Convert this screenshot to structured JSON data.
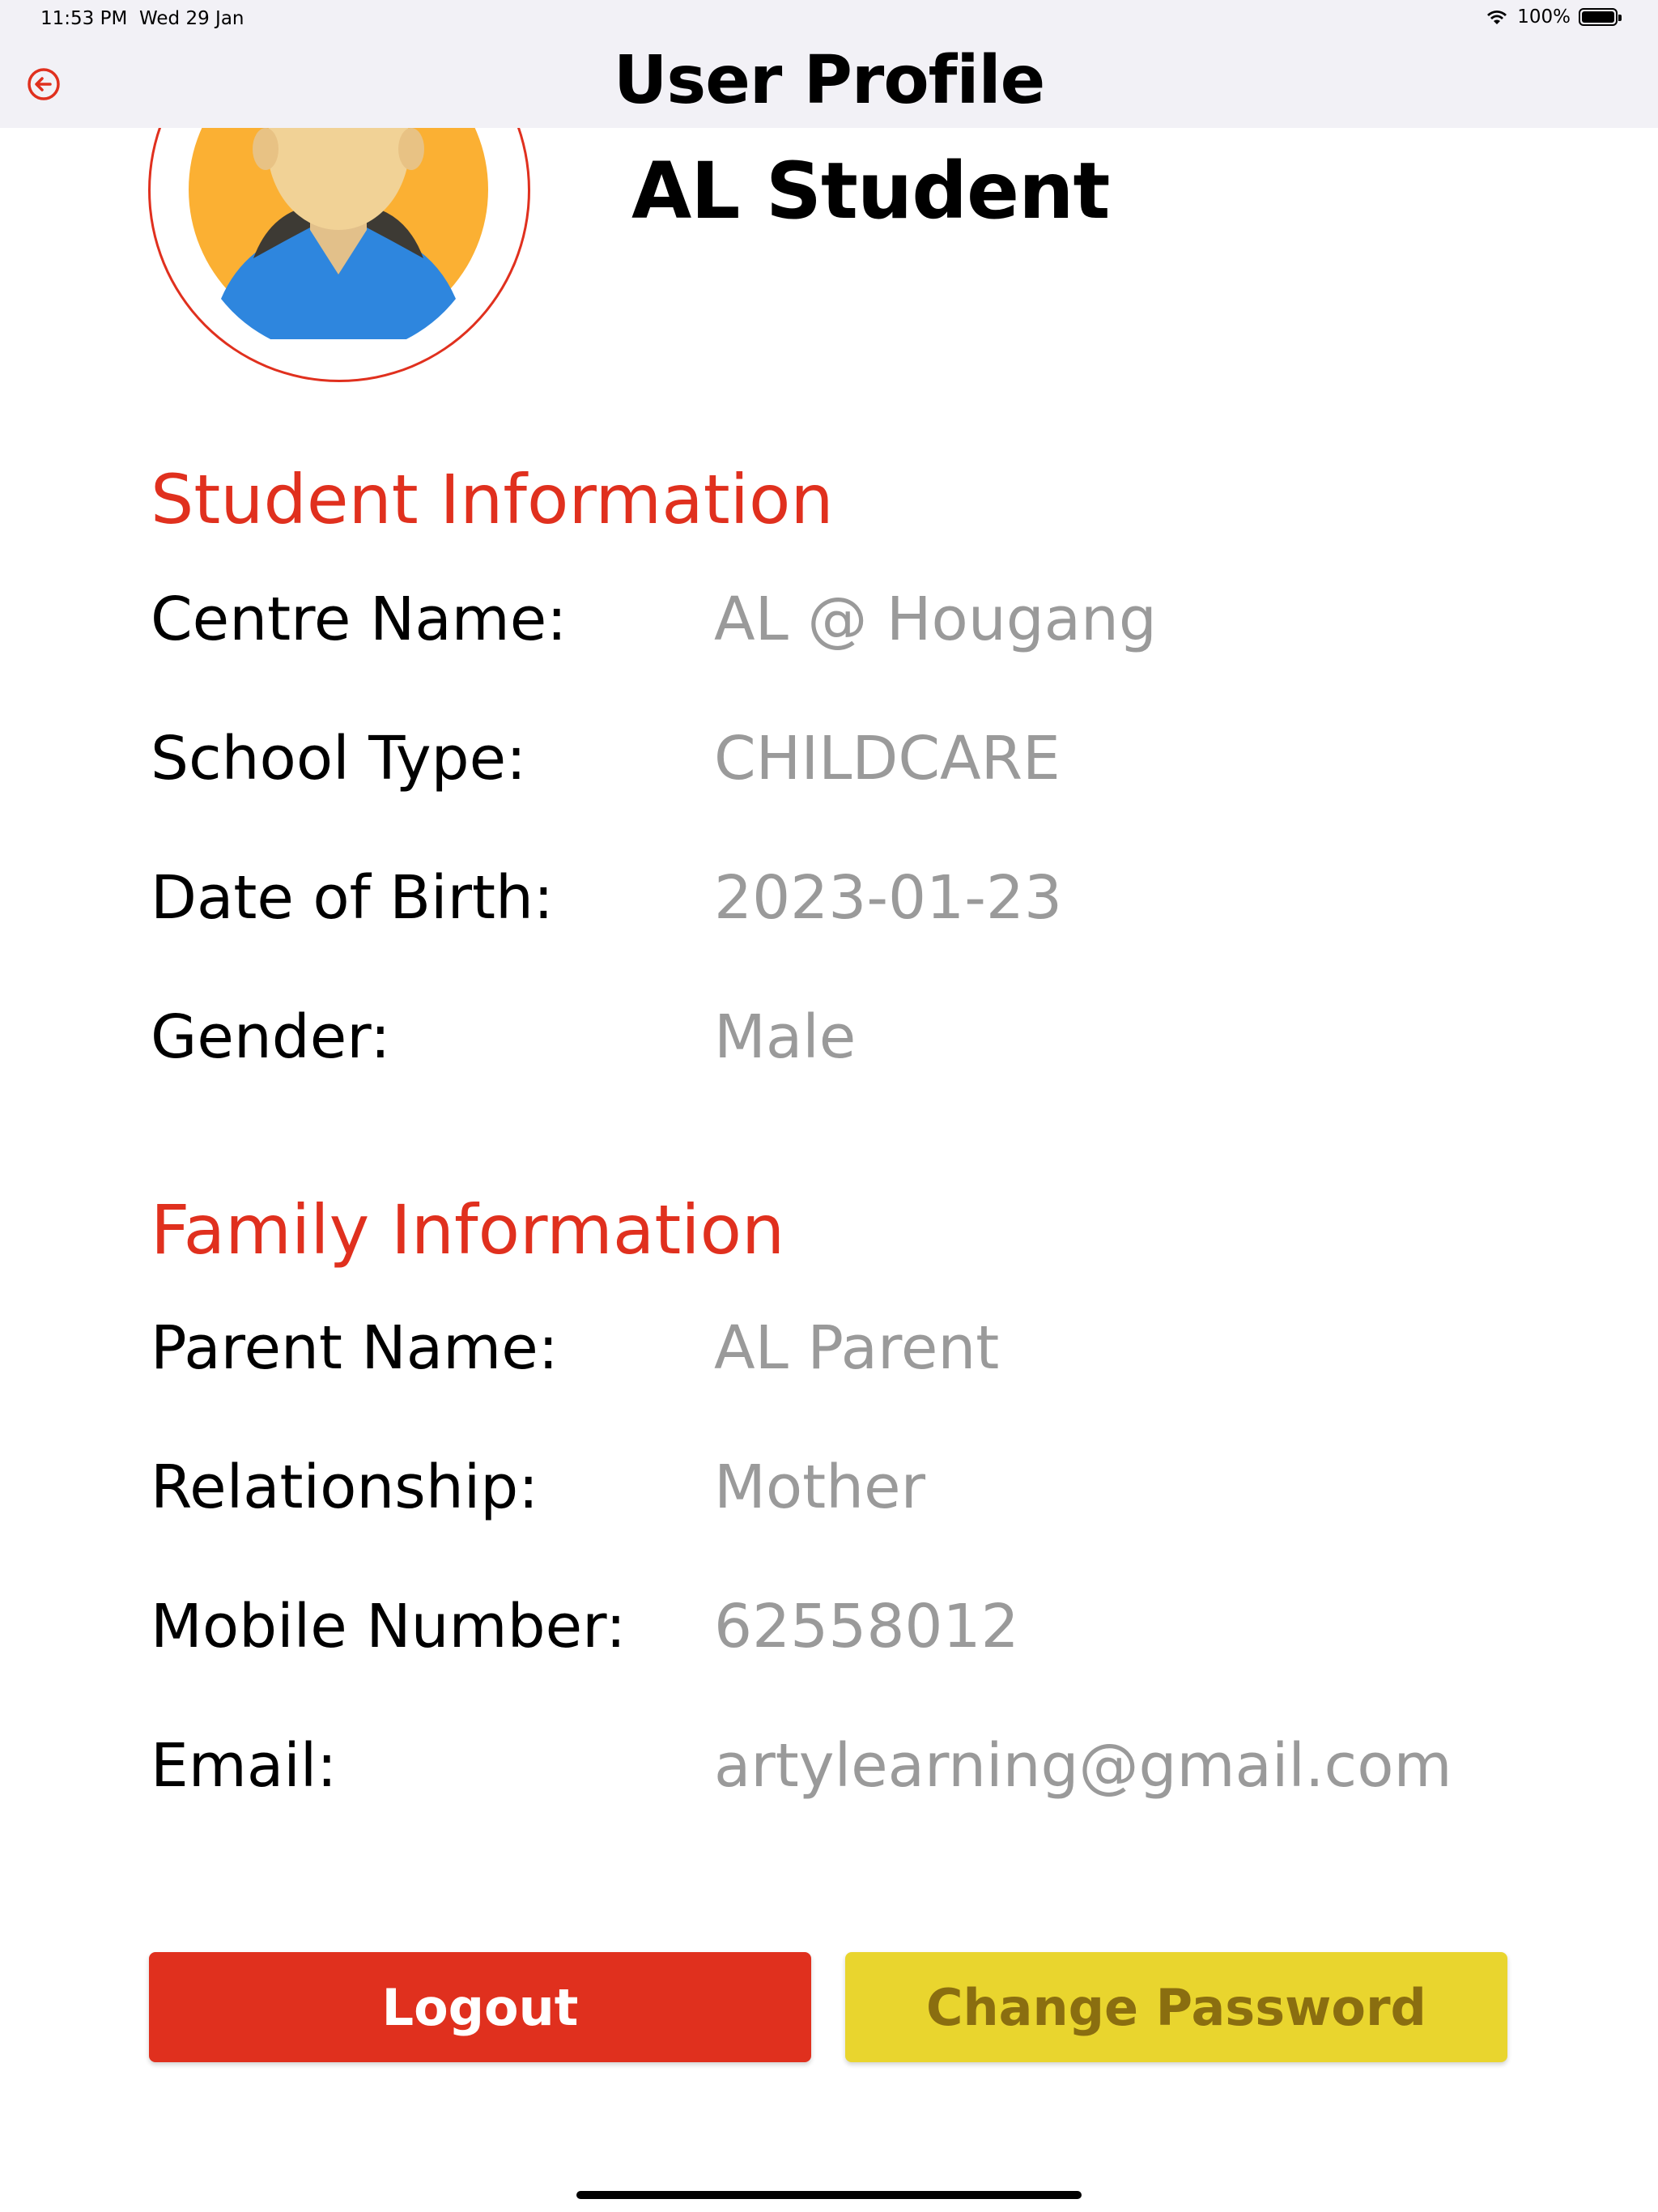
{
  "status_bar": {
    "time": "11:53 PM",
    "date": "Wed 29 Jan",
    "battery": "100%"
  },
  "header": {
    "title": "User Profile",
    "back_icon": "back-arrow-circle-icon"
  },
  "profile": {
    "name": "AL Student",
    "avatar_icon": "user-avatar-icon"
  },
  "student_info": {
    "title": "Student Information",
    "rows": [
      {
        "label": "Centre Name:",
        "value": "AL @ Hougang"
      },
      {
        "label": "School Type:",
        "value": "CHILDCARE"
      },
      {
        "label": "Date of Birth:",
        "value": "2023-01-23"
      },
      {
        "label": "Gender:",
        "value": "Male"
      }
    ]
  },
  "family_info": {
    "title": "Family Information",
    "rows": [
      {
        "label": "Parent Name:",
        "value": "AL Parent"
      },
      {
        "label": "Relationship:",
        "value": "Mother"
      },
      {
        "label": "Mobile Number:",
        "value": "62558012"
      },
      {
        "label": "Email:",
        "value": "artylearning@gmail.com"
      }
    ]
  },
  "actions": {
    "logout_label": "Logout",
    "change_password_label": "Change Password"
  },
  "colors": {
    "accent_red": "#e0301e",
    "accent_yellow": "#e9d52e",
    "value_gray": "#9a9a9a",
    "header_bg": "#f2f1f6"
  }
}
